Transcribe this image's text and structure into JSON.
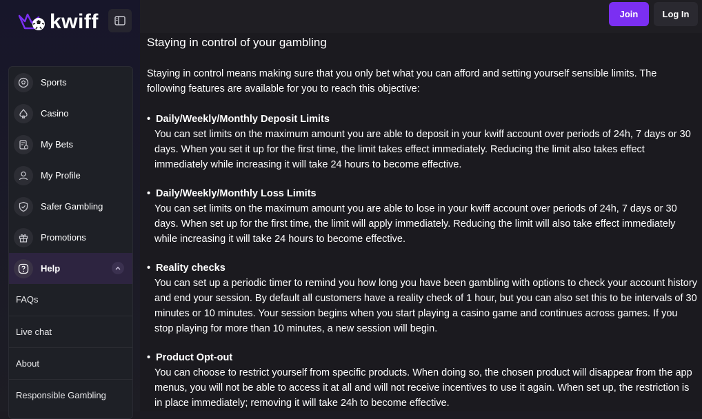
{
  "brand": {
    "name": "kwiff"
  },
  "header": {
    "join_label": "Join",
    "login_label": "Log In"
  },
  "sidebar": {
    "items": [
      {
        "label": "Sports",
        "icon": "soccer-ball-icon"
      },
      {
        "label": "Casino",
        "icon": "spade-icon"
      },
      {
        "label": "My Bets",
        "icon": "bet-slip-icon"
      },
      {
        "label": "My Profile",
        "icon": "user-icon"
      },
      {
        "label": "Safer Gambling",
        "icon": "shield-icon"
      },
      {
        "label": "Promotions",
        "icon": "gift-icon"
      },
      {
        "label": "Help",
        "icon": "help-icon",
        "expanded": true
      }
    ],
    "help_subitems": [
      {
        "label": "FAQs"
      },
      {
        "label": "Live chat"
      },
      {
        "label": "About"
      },
      {
        "label": "Responsible Gambling"
      }
    ]
  },
  "main": {
    "title": "Staying in control of your gambling",
    "intro": "Staying in control means making sure that you only bet what you can afford and setting yourself sensible limits. The following features are available for you to reach this objective:",
    "sections": [
      {
        "heading": "Daily/Weekly/Monthly Deposit Limits",
        "body": "You can set limits on the maximum amount you are able to deposit in your kwiff account over periods of 24h, 7 days or 30 days. When you set it up for the first time, the limit takes effect immediately. Reducing the limit also takes effect immediately while increasing it will take 24 hours to become effective."
      },
      {
        "heading": "Daily/Weekly/Monthly Loss Limits",
        "body": "You can set limits on the maximum amount you are able to lose in your kwiff account over periods of 24h, 7 days or 30 days. When set up for the first time, the limit will apply immediately. Reducing the limit will also take effect immediately while increasing it will take 24 hours to become effective."
      },
      {
        "heading": "Reality checks",
        "body": "You can set up a periodic timer to remind you how long you have been gambling with options to check your account history and end your session. By default all customers have a reality check of 1 hour, but you can also set this to be intervals of 30 minutes or 10 minutes. Your session begins when you start playing a casino game and continues across games. If you stop playing for more than 10 minutes, a new session will begin."
      },
      {
        "heading": "Product Opt-out",
        "body": "You can choose to restrict yourself from specific products. When doing so, the chosen product will disappear from the app menus, you will not be able to access it at all and will not receive incentives to use it again. When set up, the restriction is in place immediately; removing it will take 24h to become effective."
      }
    ]
  },
  "colors": {
    "accent": "#7b2ff2",
    "background": "#1b1a1f",
    "sidebar": "#1e2026"
  }
}
